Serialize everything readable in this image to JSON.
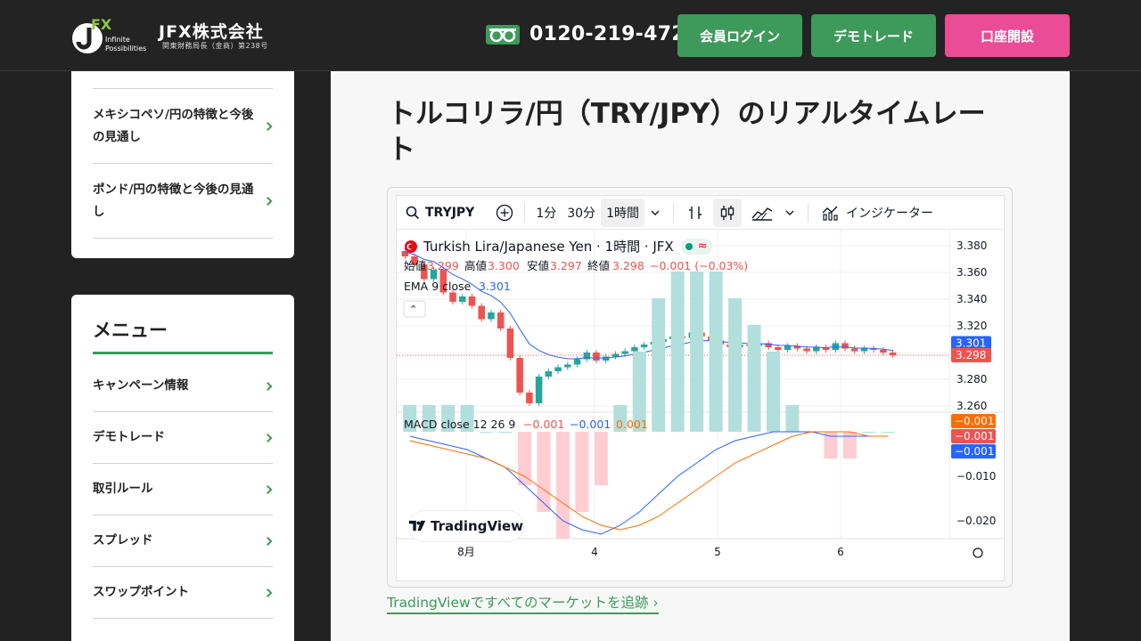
{
  "header": {
    "logo_letters": "FX",
    "logo_tagline_1": "Infinite",
    "logo_tagline_2": "Possibilities",
    "company": "JFX株式会社",
    "company_sub": "関東財務局長（金商）第238号",
    "phone": "0120-219-472",
    "login_label": "会員ログイン",
    "demo_label": "デモトレード",
    "open_label": "口座開設",
    "colors": {
      "green": "#3d9a5b",
      "pink": "#ea4c96"
    }
  },
  "sidebar_top": {
    "items": [
      {
        "label": "メキシコペソ/円の特徴と今後の見通し"
      },
      {
        "label": "ポンド/円の特徴と今後の見通し"
      }
    ]
  },
  "menu": {
    "title": "メニュー",
    "items": [
      {
        "label": "キャンペーン情報"
      },
      {
        "label": "デモトレード"
      },
      {
        "label": "取引ルール"
      },
      {
        "label": "スプレッド"
      },
      {
        "label": "スワップポイント"
      }
    ]
  },
  "main": {
    "title": "トルコリラ/円（TRY/JPY）のリアルタイムレート",
    "tv_link": "TradingViewですべてのマーケットを追跡 ›"
  },
  "toolbar": {
    "symbol": "TRYJPY",
    "tf_1m": "1分",
    "tf_30m": "30分",
    "tf_1h": "1時間",
    "indicators": "インジケーター"
  },
  "legend": {
    "symbol_title": "Turkish Lira/Japanese Yen · 1時間 · JFX",
    "open_label": "始値",
    "open": "3.299",
    "high_label": "高値",
    "high": "3.300",
    "low_label": "安値",
    "low": "3.297",
    "close_label": "終値",
    "close": "3.298",
    "change": "−0.001 (−0.03%)",
    "ema_label": "EMA 9 close",
    "ema": "3.301",
    "macd_label": "MACD close 12 26 9",
    "macd_hist": "−0.001",
    "macd_line": "−0.001",
    "macd_signal": "0.001",
    "tv_brand": "TradingView"
  },
  "chart_data": {
    "type": "line",
    "title": "",
    "price_axis": [
      "3.380",
      "3.360",
      "3.340",
      "3.320",
      "3.300",
      "3.280",
      "3.260"
    ],
    "price_ticks": [
      3.38,
      3.36,
      3.34,
      3.32,
      3.3,
      3.28,
      3.26
    ],
    "macd_axis": [
      "−0.010",
      "−0.020"
    ],
    "macd_ticks": [
      -0.01,
      -0.02
    ],
    "x_labels": [
      "8月",
      "4",
      "5",
      "6"
    ],
    "current_ema": 3.301,
    "current_close": 3.298,
    "price_tags": [
      "3.301",
      "3.298"
    ],
    "macd_tags": [
      "−0.001",
      "−0.001",
      "−0.001"
    ],
    "colors": {
      "up": "#26a69a",
      "down": "#ef5350",
      "ema": "#2962ff",
      "signal": "#ff6d00"
    },
    "closes": [
      3.372,
      3.366,
      3.355,
      3.362,
      3.345,
      3.338,
      3.342,
      3.335,
      3.325,
      3.33,
      3.318,
      3.296,
      3.27,
      3.262,
      3.282,
      3.286,
      3.289,
      3.291,
      3.295,
      3.3,
      3.294,
      3.297,
      3.299,
      3.301,
      3.304,
      3.306,
      3.308,
      3.31,
      3.312,
      3.311,
      3.315,
      3.312,
      3.309,
      3.306,
      3.304,
      3.306,
      3.305,
      3.307,
      3.304,
      3.302,
      3.305,
      3.303,
      3.301,
      3.304,
      3.302,
      3.307,
      3.303,
      3.301,
      3.303,
      3.302,
      3.3,
      3.298
    ],
    "macd": [
      -0.001,
      -0.002,
      -0.003,
      -0.004,
      -0.006,
      -0.008,
      -0.012,
      -0.016,
      -0.02,
      -0.022,
      -0.023,
      -0.021,
      -0.018,
      -0.014,
      -0.01,
      -0.007,
      -0.004,
      -0.002,
      -0.001,
      0.0,
      0.0,
      0.0,
      -0.001,
      -0.001,
      -0.001,
      -0.001
    ],
    "signal": [
      -0.002,
      -0.003,
      -0.004,
      -0.005,
      -0.006,
      -0.008,
      -0.01,
      -0.013,
      -0.016,
      -0.019,
      -0.021,
      -0.022,
      -0.021,
      -0.019,
      -0.016,
      -0.013,
      -0.01,
      -0.007,
      -0.005,
      -0.003,
      -0.001,
      0.0,
      0.0,
      0.0,
      -0.001,
      -0.001
    ]
  }
}
